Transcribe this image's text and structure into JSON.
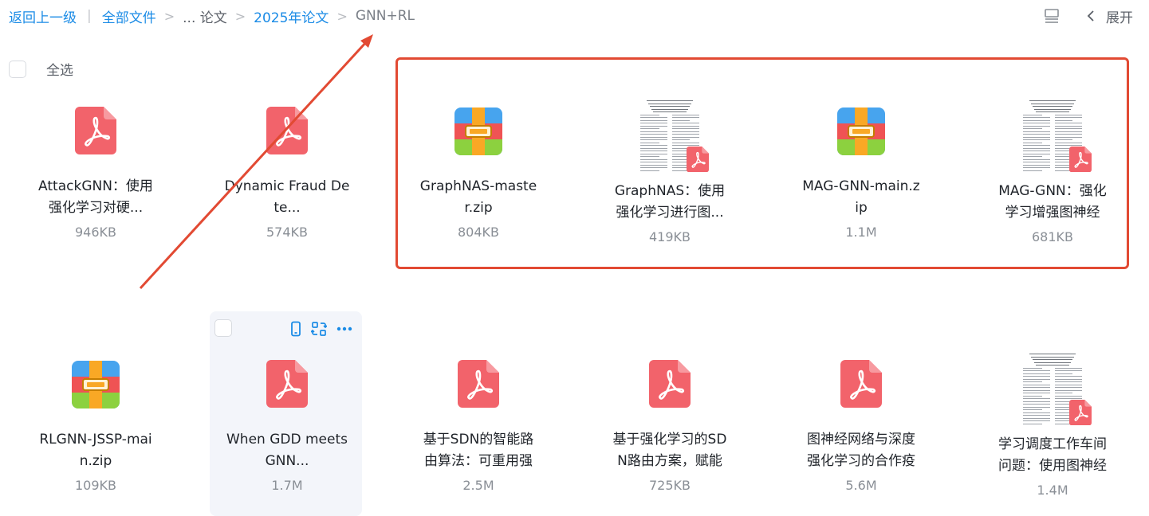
{
  "breadcrumb": {
    "back": "返回上一级",
    "all_files": "全部文件",
    "ellipsis_folder": "... 论文",
    "year_folder": "2025年论文",
    "current": "GNN+RL"
  },
  "toolbar": {
    "collapse_label": "展开"
  },
  "select_all_label": "全选",
  "files": [
    {
      "name_l1": "AttackGNN：使用",
      "name_l2": "强化学习对硬...",
      "size": "946KB",
      "type": "pdf"
    },
    {
      "name_l1": "Dynamic Fraud De",
      "name_l2": "te...",
      "size": "574KB",
      "type": "pdf"
    },
    {
      "name_l1": "GraphNAS-maste",
      "name_l2": "r.zip",
      "size": "804KB",
      "type": "zip"
    },
    {
      "name_l1": "GraphNAS：使用",
      "name_l2": "强化学习进行图...",
      "size": "419KB",
      "type": "pdf-thumb"
    },
    {
      "name_l1": "MAG-GNN-main.z",
      "name_l2": "ip",
      "size": "1.1M",
      "type": "zip"
    },
    {
      "name_l1": "MAG-GNN：强化",
      "name_l2": "学习增强图神经",
      "size": "681KB",
      "type": "pdf-thumb"
    },
    {
      "name_l1": "RLGNN-JSSP-mai",
      "name_l2": "n.zip",
      "size": "109KB",
      "type": "zip"
    },
    {
      "name_l1": "When GDD meets",
      "name_l2": "GNN...",
      "size": "1.7M",
      "type": "pdf"
    },
    {
      "name_l1": "基于SDN的智能路",
      "name_l2": "由算法：可重用强",
      "size": "2.5M",
      "type": "pdf"
    },
    {
      "name_l1": "基于强化学习的SD",
      "name_l2": "N路由方案，赋能",
      "size": "725KB",
      "type": "pdf"
    },
    {
      "name_l1": "图神经网络与深度",
      "name_l2": "强化学习的合作疫",
      "size": "5.6M",
      "type": "pdf"
    },
    {
      "name_l1": "学习调度工作车间",
      "name_l2": "问题：使用图神经",
      "size": "1.4M",
      "type": "pdf-thumb"
    }
  ],
  "colors": {
    "link": "#1a8be6",
    "pdf": "#f2636b",
    "annotation": "#e24a33"
  }
}
